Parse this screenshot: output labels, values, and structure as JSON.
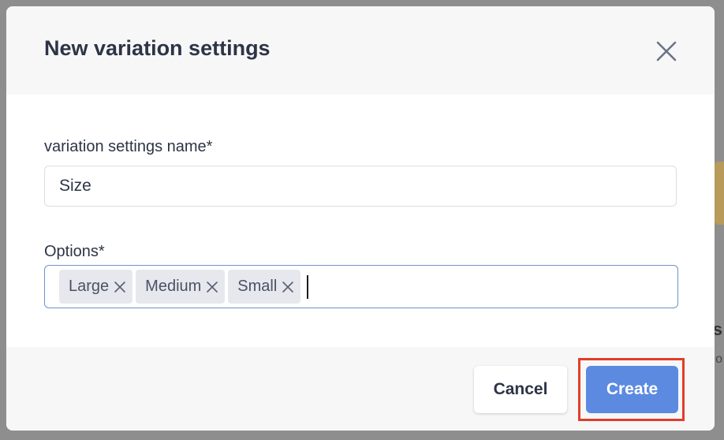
{
  "dialog": {
    "title": "New variation settings"
  },
  "name_field": {
    "label": "variation settings name*",
    "value": "Size"
  },
  "options_field": {
    "label": "Options*",
    "tags": [
      "Large",
      "Medium",
      "Small"
    ]
  },
  "footer": {
    "cancel_label": "Cancel",
    "create_label": "Create"
  },
  "colors": {
    "primary": "#5b8ae0",
    "highlight": "#e23d2a"
  },
  "icons": {
    "close": "close-icon",
    "tag_remove": "close-icon"
  }
}
